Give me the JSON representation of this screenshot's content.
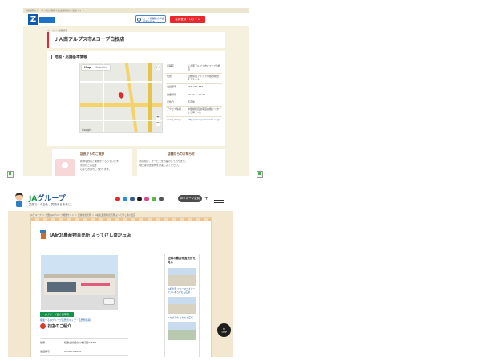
{
  "shot1": {
    "topbar_text": "供給者のクーポン及び情報や社会環境的な活動サイト",
    "logo_letter": "Z",
    "search_text": "コープ店舗名の商品検索で探す",
    "register_label": "会員登録・ログイン",
    "breadcrumb": "ホーム > 店舗検索",
    "store_title": "ＪＡ南アルプス市Aコープ白根店",
    "section_title": "地図・店舗基本情報",
    "map": {
      "tab_map": "Map",
      "tab_satellite": "Satellite",
      "google": "Google",
      "zoom_in": "+",
      "zoom_out": "−",
      "fullscreen": "⛶"
    },
    "info_rows": [
      {
        "label": "店舗名",
        "value": "ＪＡ南アルプス市Aコープ白根店"
      },
      {
        "label": "住所",
        "value": "山梨県南アルプス市飯野新田１２７５－１"
      },
      {
        "label": "電話番号",
        "value": "055-282-5841"
      },
      {
        "label": "営業時間",
        "value": "09:00 〜 19:00"
      },
      {
        "label": "定休日",
        "value": "不定休"
      },
      {
        "label": "アクセス情報",
        "value": "中部横断自動車道白根インターから車で3分"
      },
      {
        "label": "ホームページ",
        "value": "http://www.ja-minami.or.jp"
      }
    ],
    "greeting_title": "店長からのご挨拶",
    "greeting_lines": [
      "新鮮な野菜と果物がそろっています。",
      "皆様のご来店を",
      "心よりお待ちしております。"
    ],
    "news_title": "店舗からのお知らせ",
    "news_lines": [
      "お客様に、サービスをお届けしております。",
      "地元産の農産物をお楽しみください。"
    ]
  },
  "shot2": {
    "logo_ja": "JA",
    "logo_group": "グループ",
    "logo_tag": "笑顔で、今日も、笑顔ある未来に。",
    "login_label": "JAグループ会員",
    "plus": "+",
    "breadcrumb": "JAグループ ＞ 全国のJAグループ関連サイト ＞ 農産物直売所 ＞ JA紀北農産物直売所 よってけし寄ヶ丘店",
    "store_title": "JA紀北農産物直売所 よってけし望が丘店",
    "green_button": "JAグループ紹介用写真",
    "sub_link": "関連するJAグループ直売所マップ・直売所情報",
    "intro_title": "お店のご紹介",
    "table_rows": [
      {
        "label": "住所",
        "value": "和歌山県紀の川市打田1758-1"
      },
      {
        "label": "電話番号",
        "value": "0736-78-4040"
      }
    ],
    "side_title": "近隣の農産物直売所を見る",
    "side_items": [
      "JA紀の里 ファーマーズマーケットめっけもん広場",
      "JAながみね とれたて広場"
    ],
    "top_button": "TOP",
    "social_colors": [
      "#e02a27",
      "#2a8fd8",
      "#3b5998",
      "#1b1b1b",
      "#d64a8f",
      "#5bb446",
      "#555555"
    ]
  }
}
